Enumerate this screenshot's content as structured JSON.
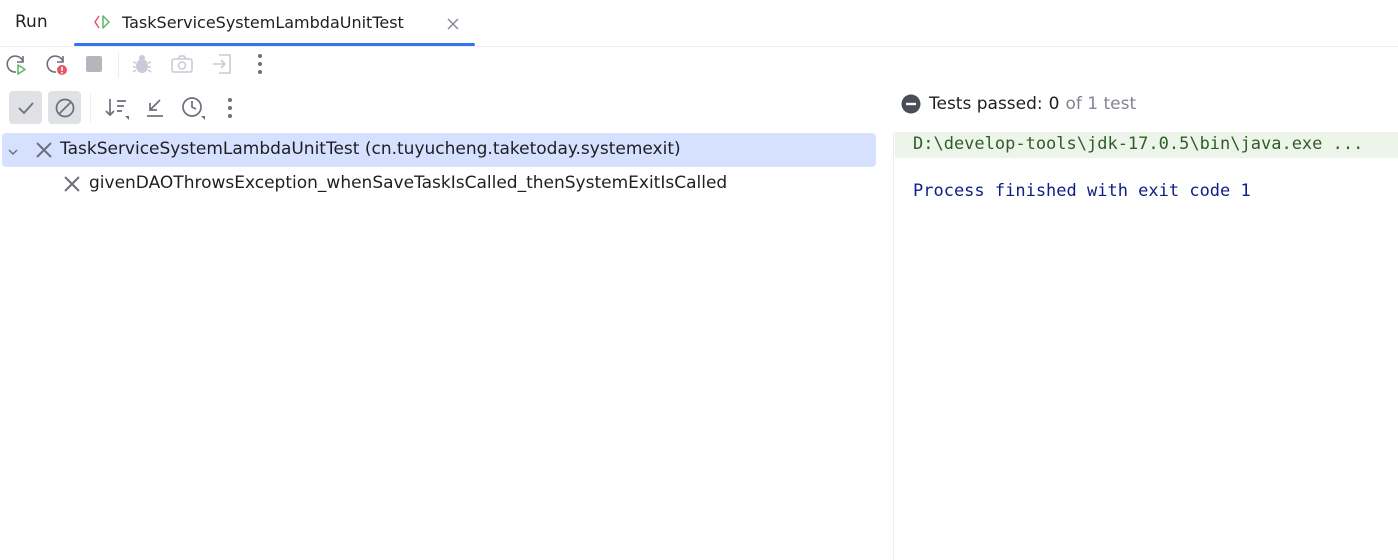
{
  "header": {
    "panel_title": "Run",
    "tab": {
      "label": "TaskServiceSystemLambdaUnitTest"
    }
  },
  "toolbar_primary": [
    {
      "icon": "rerun-icon",
      "label": "Rerun",
      "enabled": true
    },
    {
      "icon": "rerun-failed-icon",
      "label": "Rerun Failed Tests",
      "enabled": true
    },
    {
      "icon": "stop-icon",
      "label": "Stop",
      "enabled": false
    },
    {
      "icon": "debug-icon",
      "label": "Debug",
      "enabled": false
    },
    {
      "icon": "camera-icon",
      "label": "Dump Threads",
      "enabled": false
    },
    {
      "icon": "exit-icon",
      "label": "Exit",
      "enabled": false
    },
    {
      "icon": "more-vertical-icon",
      "label": "More",
      "enabled": true
    }
  ],
  "toolbar_tests": [
    {
      "icon": "show-passed-icon",
      "label": "Show Passed",
      "selected": true
    },
    {
      "icon": "show-ignored-icon",
      "label": "Show Ignored",
      "selected": true
    },
    {
      "icon": "sort-icon",
      "label": "Sort"
    },
    {
      "icon": "collapse-icon",
      "label": "Collapse"
    },
    {
      "icon": "history-icon",
      "label": "Test History"
    },
    {
      "icon": "more-vertical-icon",
      "label": "More"
    }
  ],
  "status": {
    "prefix": "Tests passed:",
    "passed": "0",
    "suffix": "of 1 test"
  },
  "test_tree": [
    {
      "level": 0,
      "expanded": true,
      "result": "failed",
      "label": "TaskServiceSystemLambdaUnitTest (cn.tuyucheng.taketoday.systemexit)",
      "selected": true
    },
    {
      "level": 1,
      "result": "failed",
      "label": "givenDAOThrowsException_whenSaveTaskIsCalled_thenSystemExitIsCalled",
      "selected": false
    }
  ],
  "console": {
    "command": "D:\\develop-tools\\jdk-17.0.5\\bin\\java.exe ...",
    "exit_message": "Process finished with exit code 1"
  },
  "colors": {
    "accent": "#3574f0",
    "selected_row": "#d5e1ff",
    "command_bg": "#edf5ea",
    "failed_icon": "#6c707e",
    "error_badge": "#e55765"
  }
}
